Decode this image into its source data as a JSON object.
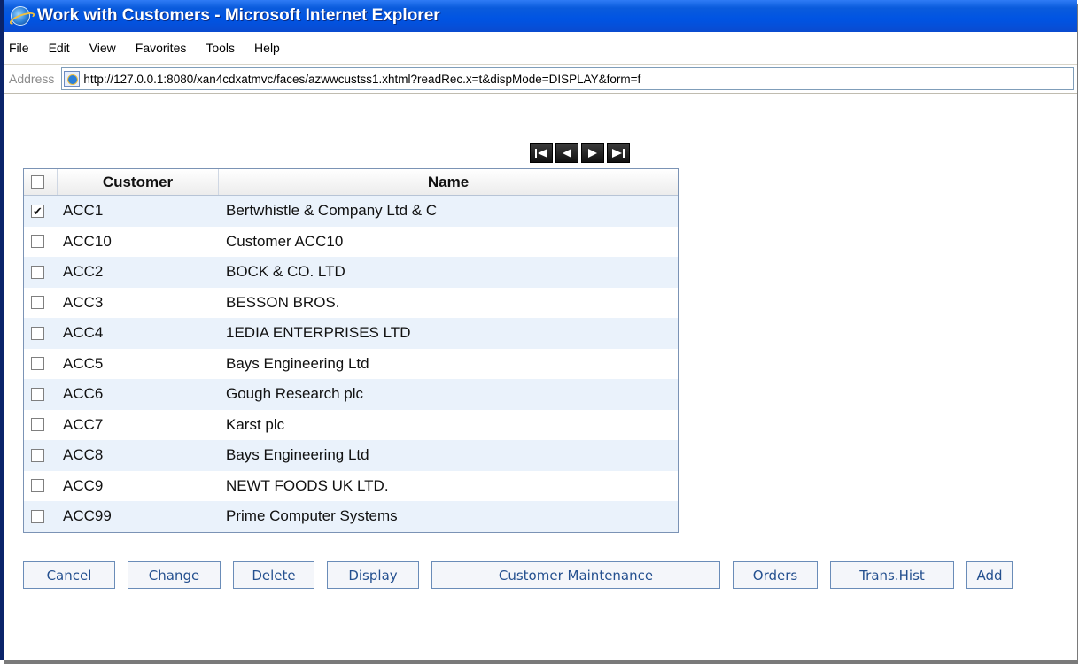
{
  "window": {
    "title": "Work with Customers - Microsoft Internet Explorer"
  },
  "menu": [
    "File",
    "Edit",
    "View",
    "Favorites",
    "Tools",
    "Help"
  ],
  "address": {
    "label": "Address",
    "url": "http://127.0.0.1:8080/xan4cdxatmvc/faces/azwwcustss1.xhtml?readRec.x=t&dispMode=DISPLAY&form=f"
  },
  "pager": {
    "first": "◀◀",
    "prev": "◀",
    "next": "▶",
    "last": "▶▶"
  },
  "grid": {
    "columns": {
      "customer": "Customer",
      "name": "Name"
    },
    "rows": [
      {
        "checked": true,
        "customer": "ACC1",
        "name": "Bertwhistle & Company Ltd & C"
      },
      {
        "checked": false,
        "customer": "ACC10",
        "name": "Customer ACC10"
      },
      {
        "checked": false,
        "customer": "ACC2",
        "name": "BOCK & CO. LTD"
      },
      {
        "checked": false,
        "customer": "ACC3",
        "name": "BESSON BROS."
      },
      {
        "checked": false,
        "customer": "ACC4",
        "name": "1EDIA ENTERPRISES LTD"
      },
      {
        "checked": false,
        "customer": "ACC5",
        "name": "Bays Engineering Ltd"
      },
      {
        "checked": false,
        "customer": "ACC6",
        "name": "Gough Research plc"
      },
      {
        "checked": false,
        "customer": "ACC7",
        "name": "Karst plc"
      },
      {
        "checked": false,
        "customer": "ACC8",
        "name": "Bays Engineering Ltd"
      },
      {
        "checked": false,
        "customer": "ACC9",
        "name": "NEWT FOODS UK LTD."
      },
      {
        "checked": false,
        "customer": "ACC99",
        "name": "Prime Computer Systems"
      }
    ]
  },
  "buttons": {
    "cancel": "Cancel",
    "change": "Change",
    "delete": "Delete",
    "display": "Display",
    "customer_maintenance": "Customer Maintenance",
    "orders": "Orders",
    "trans_hist": "Trans.Hist",
    "add": "Add"
  },
  "icons": {
    "browser": "internet-explorer-icon",
    "page": "page-icon",
    "checked_mark": "✔"
  }
}
